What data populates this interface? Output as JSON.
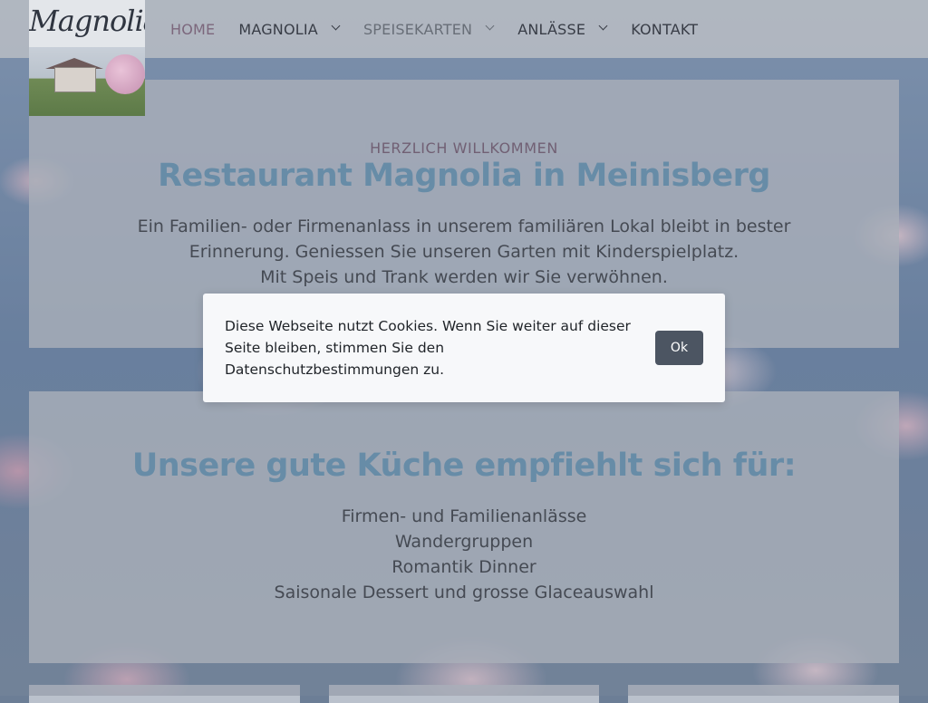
{
  "logo": {
    "text": "Magnolia"
  },
  "nav": {
    "items": [
      {
        "label": "HOME",
        "dropdown": false,
        "state": "active"
      },
      {
        "label": "MAGNOLIA",
        "dropdown": true,
        "state": "normal"
      },
      {
        "label": "SPEISEKARTEN",
        "dropdown": true,
        "state": "muted"
      },
      {
        "label": "ANLÄSSE",
        "dropdown": true,
        "state": "normal"
      },
      {
        "label": "KONTAKT",
        "dropdown": false,
        "state": "normal"
      }
    ]
  },
  "welcome": {
    "eyebrow": "HERZLICH WILLKOMMEN",
    "title": "Restaurant Magnolia in Meinisberg",
    "lines": [
      "Ein Familien- oder Firmenanlass in unserem familiären Lokal  bleibt in bester",
      "Erinnerung. Geniessen Sie unseren Garten mit Kinderspielplatz.",
      "Mit Speis und Trank werden wir Sie verwöhnen."
    ]
  },
  "kitchen": {
    "title": "Unsere gute Küche empfiehlt sich für:",
    "items": [
      "Firmen- und Familienanlässe",
      "Wandergruppen",
      "Romantik Dinner",
      "Saisonale Dessert und grosse Glaceauswahl"
    ]
  },
  "cookie": {
    "text": "Diese Webseite nutzt Cookies. Wenn Sie weiter auf dieser Seite bleiben, stimmen Sie den Datenschutzbestimmungen zu.",
    "button": "Ok"
  },
  "colors": {
    "accent_heading": "#6c9dbd",
    "nav_active": "#8a6a82",
    "button": "#4c5562"
  }
}
